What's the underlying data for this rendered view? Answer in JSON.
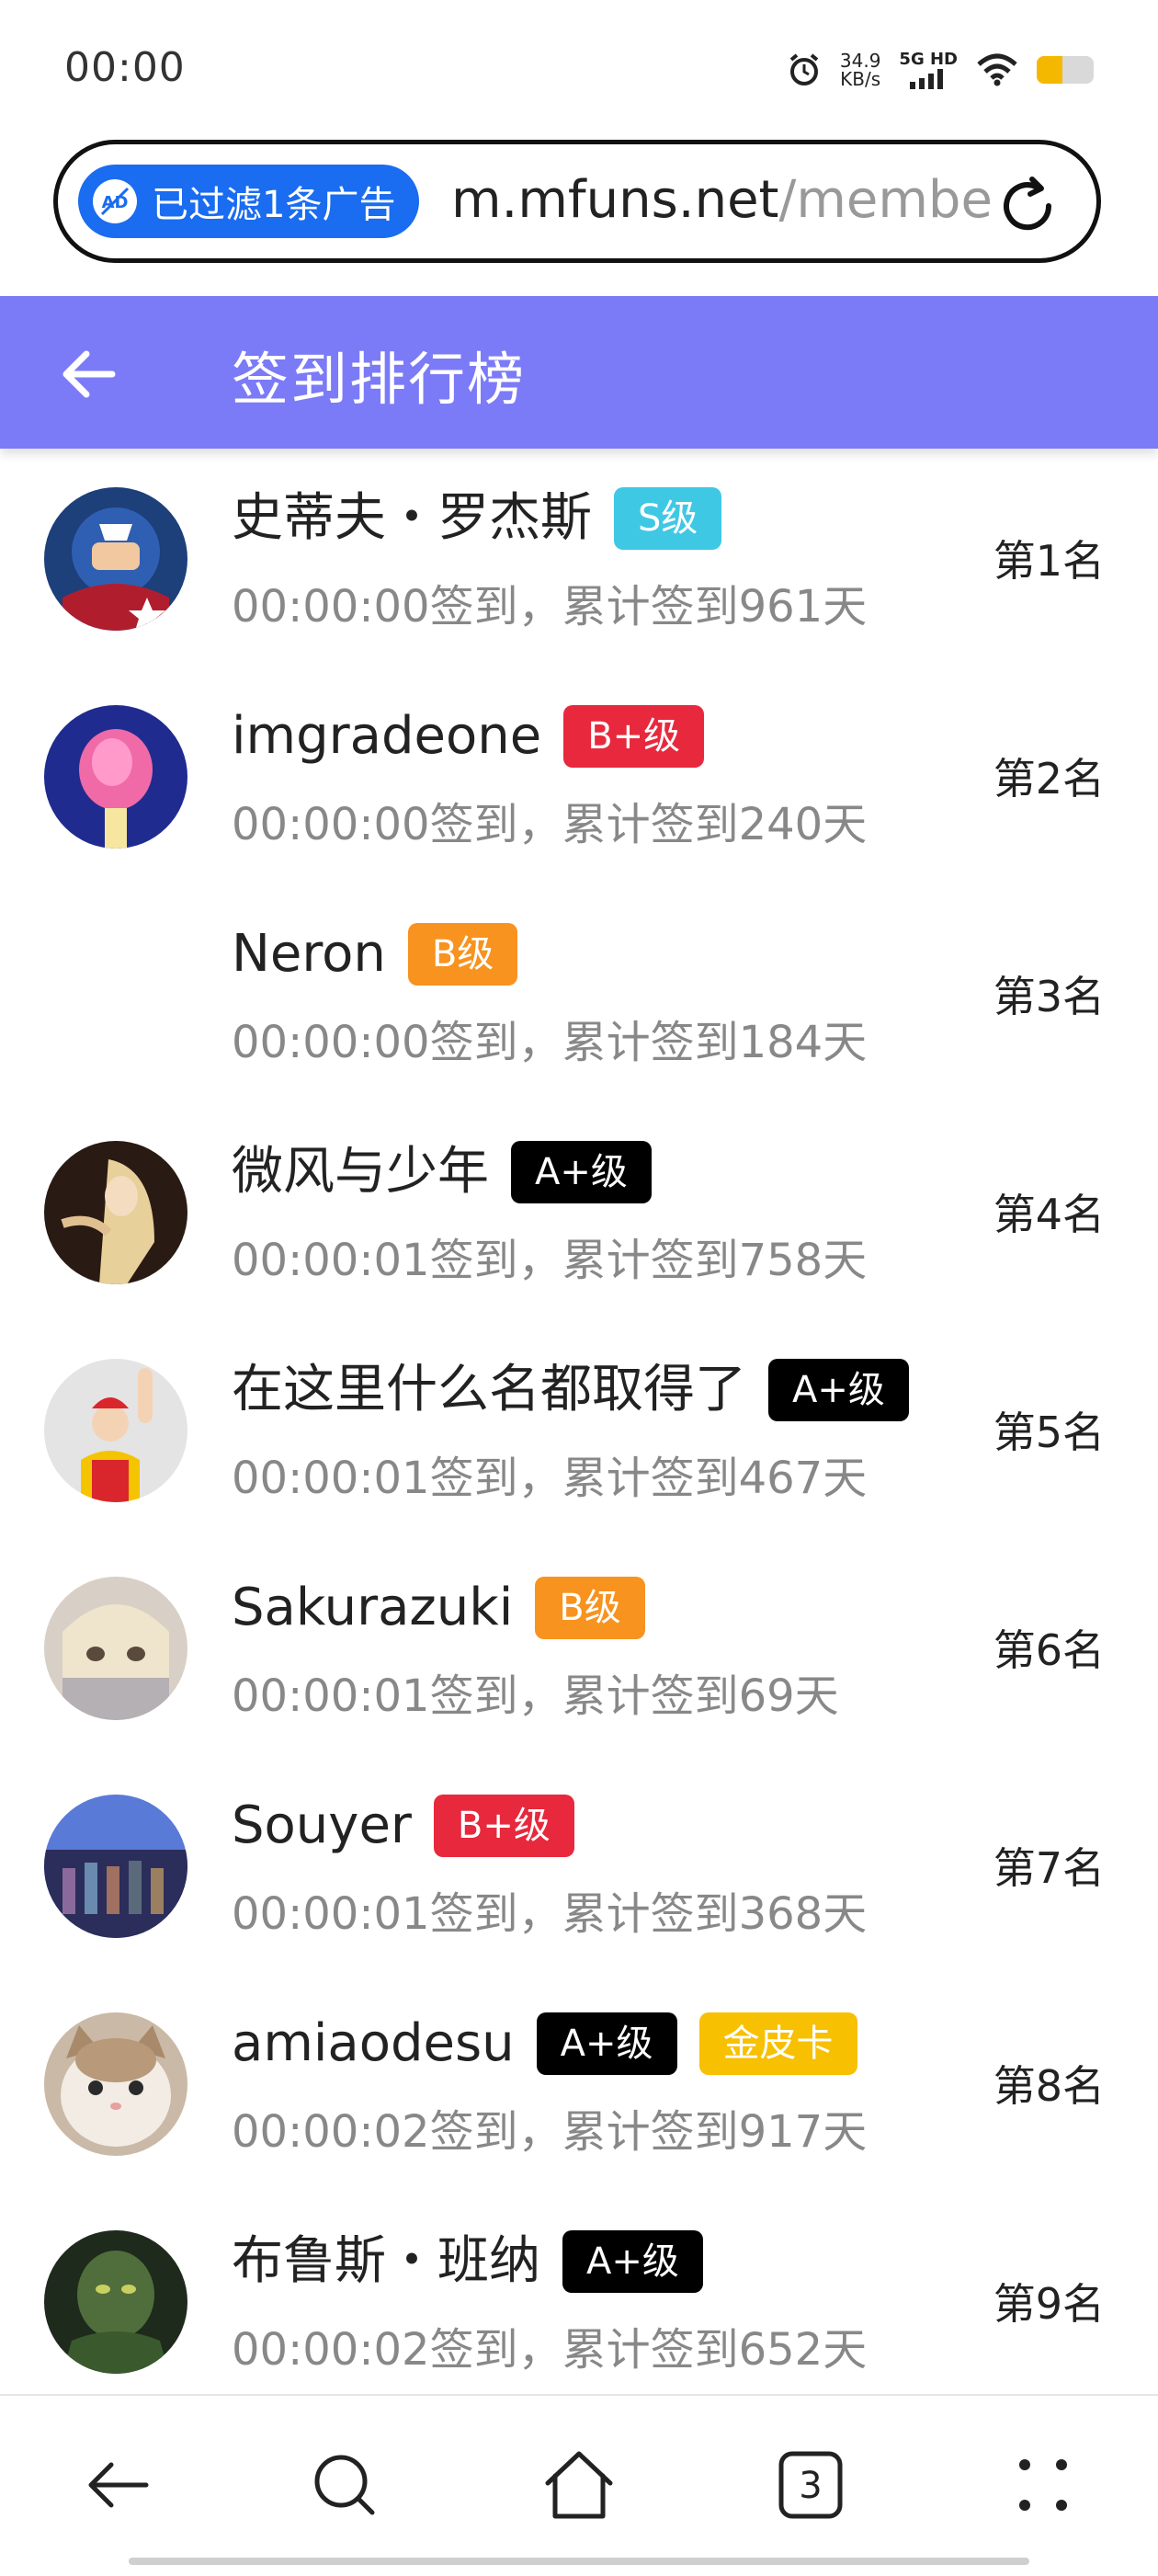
{
  "status_bar": {
    "time": "00:00",
    "net_speed_value": "34.9",
    "net_speed_unit": "KB/s",
    "network_type": "5G HD",
    "battery_level": 0.45
  },
  "browser": {
    "ad_filter_label": "已过滤1条广告",
    "url_host": "m.mfuns.net",
    "url_path": "/membe"
  },
  "header": {
    "title": "签到排行榜"
  },
  "colors": {
    "header_bg": "#7b7bf7",
    "badge_s": "#3fc8e4",
    "badge_b_plus": "#e8283c",
    "badge_b": "#f7931e",
    "badge_a_plus": "#000000",
    "badge_gold_card": "#f7c000",
    "ad_pill": "#1a6cf0"
  },
  "rows": [
    {
      "name": "史蒂夫・罗杰斯",
      "badges": [
        "S级"
      ],
      "info": "00:00:00签到，累计签到961天",
      "rank": "第1名"
    },
    {
      "name": "imgradeone",
      "badges": [
        "B+级"
      ],
      "info": "00:00:00签到，累计签到240天",
      "rank": "第2名"
    },
    {
      "name": "Neron",
      "badges": [
        "B级"
      ],
      "info": "00:00:00签到，累计签到184天",
      "rank": "第3名"
    },
    {
      "name": "微风与少年",
      "badges": [
        "A+级"
      ],
      "info": "00:00:01签到，累计签到758天",
      "rank": "第4名"
    },
    {
      "name": "在这里什么名都取得了",
      "badges": [
        "A+级"
      ],
      "info": "00:00:01签到，累计签到467天",
      "rank": "第5名"
    },
    {
      "name": "Sakurazuki",
      "badges": [
        "B级"
      ],
      "info": "00:00:01签到，累计签到69天",
      "rank": "第6名"
    },
    {
      "name": "Souyer",
      "badges": [
        "B+级"
      ],
      "info": "00:00:01签到，累计签到368天",
      "rank": "第7名"
    },
    {
      "name": "amiaodesu",
      "badges": [
        "A+级",
        "金皮卡"
      ],
      "info": "00:00:02签到，累计签到917天",
      "rank": "第8名"
    },
    {
      "name": "布鲁斯・班纳",
      "badges": [
        "A+级"
      ],
      "info": "00:00:02签到，累计签到652天",
      "rank": "第9名"
    }
  ],
  "bottom_nav": {
    "tab_count": "3",
    "icons": [
      "back-arrow-icon",
      "search-icon",
      "home-icon",
      "tabs-icon",
      "more-icon"
    ]
  }
}
